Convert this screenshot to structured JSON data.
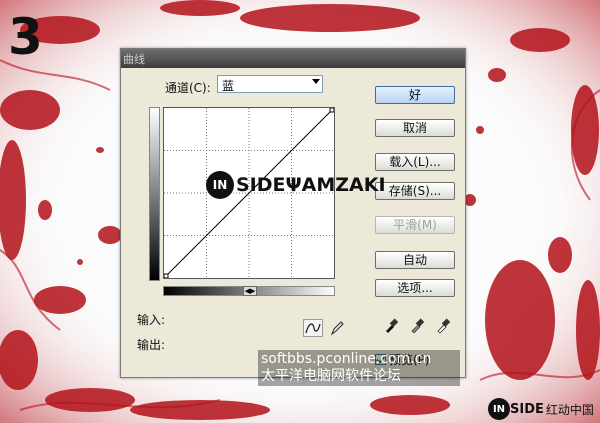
{
  "step_number": "3",
  "dialog": {
    "title": "曲线",
    "channel_label": "通道(C):",
    "channel_value": "蓝",
    "input_label": "输入:",
    "output_label": "输出:",
    "buttons": {
      "ok": "好",
      "cancel": "取消",
      "load": "载入(L)...",
      "save": "存储(S)...",
      "smooth": "平滑(M)",
      "auto": "自动",
      "options": "选项..."
    },
    "preview_label": "预览(P)",
    "preview_checked": true
  },
  "watermarks": {
    "logo_circle": "IN",
    "logo_text": "SIDEΨAMZAKI",
    "site_line1": "softbbs.pconline.com.cn",
    "site_line2": "太平洋电脑网软件论坛",
    "corner_circle": "IN",
    "corner_text": "SIDE",
    "corner_sub": "红动中国"
  },
  "colors": {
    "blood": "#b3121a",
    "default_button": "#b9d3f1"
  }
}
